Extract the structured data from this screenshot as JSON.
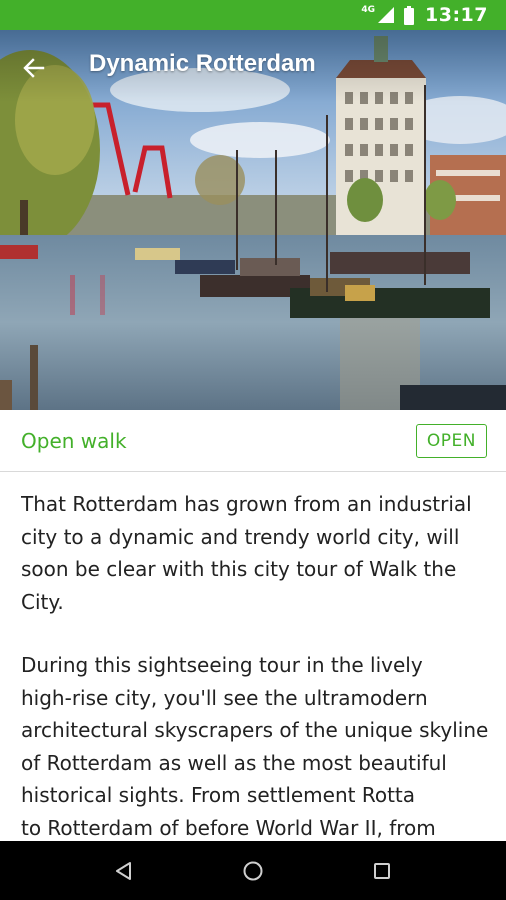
{
  "status_bar": {
    "time": "13:17",
    "network_label": "4G",
    "icons": [
      "signal-icon",
      "battery-icon"
    ]
  },
  "header": {
    "title": "Dynamic Rotterdam",
    "back_icon": "arrow-back-icon"
  },
  "walk": {
    "label": "Open walk",
    "button_label": "OPEN"
  },
  "description": {
    "paragraphs": [
      "That Rotterdam has grown from an industrial\ncity to a dynamic and trendy world city, will\nsoon be clear with this city tour of Walk the\nCity.",
      "During this sightseeing tour in the lively\nhigh-rise city, you'll see the ultramodern\narchitectural skyscrapers of the unique skyline\nof Rotterdam as well as the most beautiful\nhistorical sights. From settlement Rotta\nto Rotterdam of before World War II, from"
    ]
  },
  "nav_bar": {
    "icons": [
      "back-triangle-icon",
      "home-circle-icon",
      "recents-square-icon"
    ]
  },
  "colors": {
    "accent": "#43b02a",
    "status_bar": "#43b02a",
    "nav_bar": "#000000",
    "text": "#222222"
  }
}
